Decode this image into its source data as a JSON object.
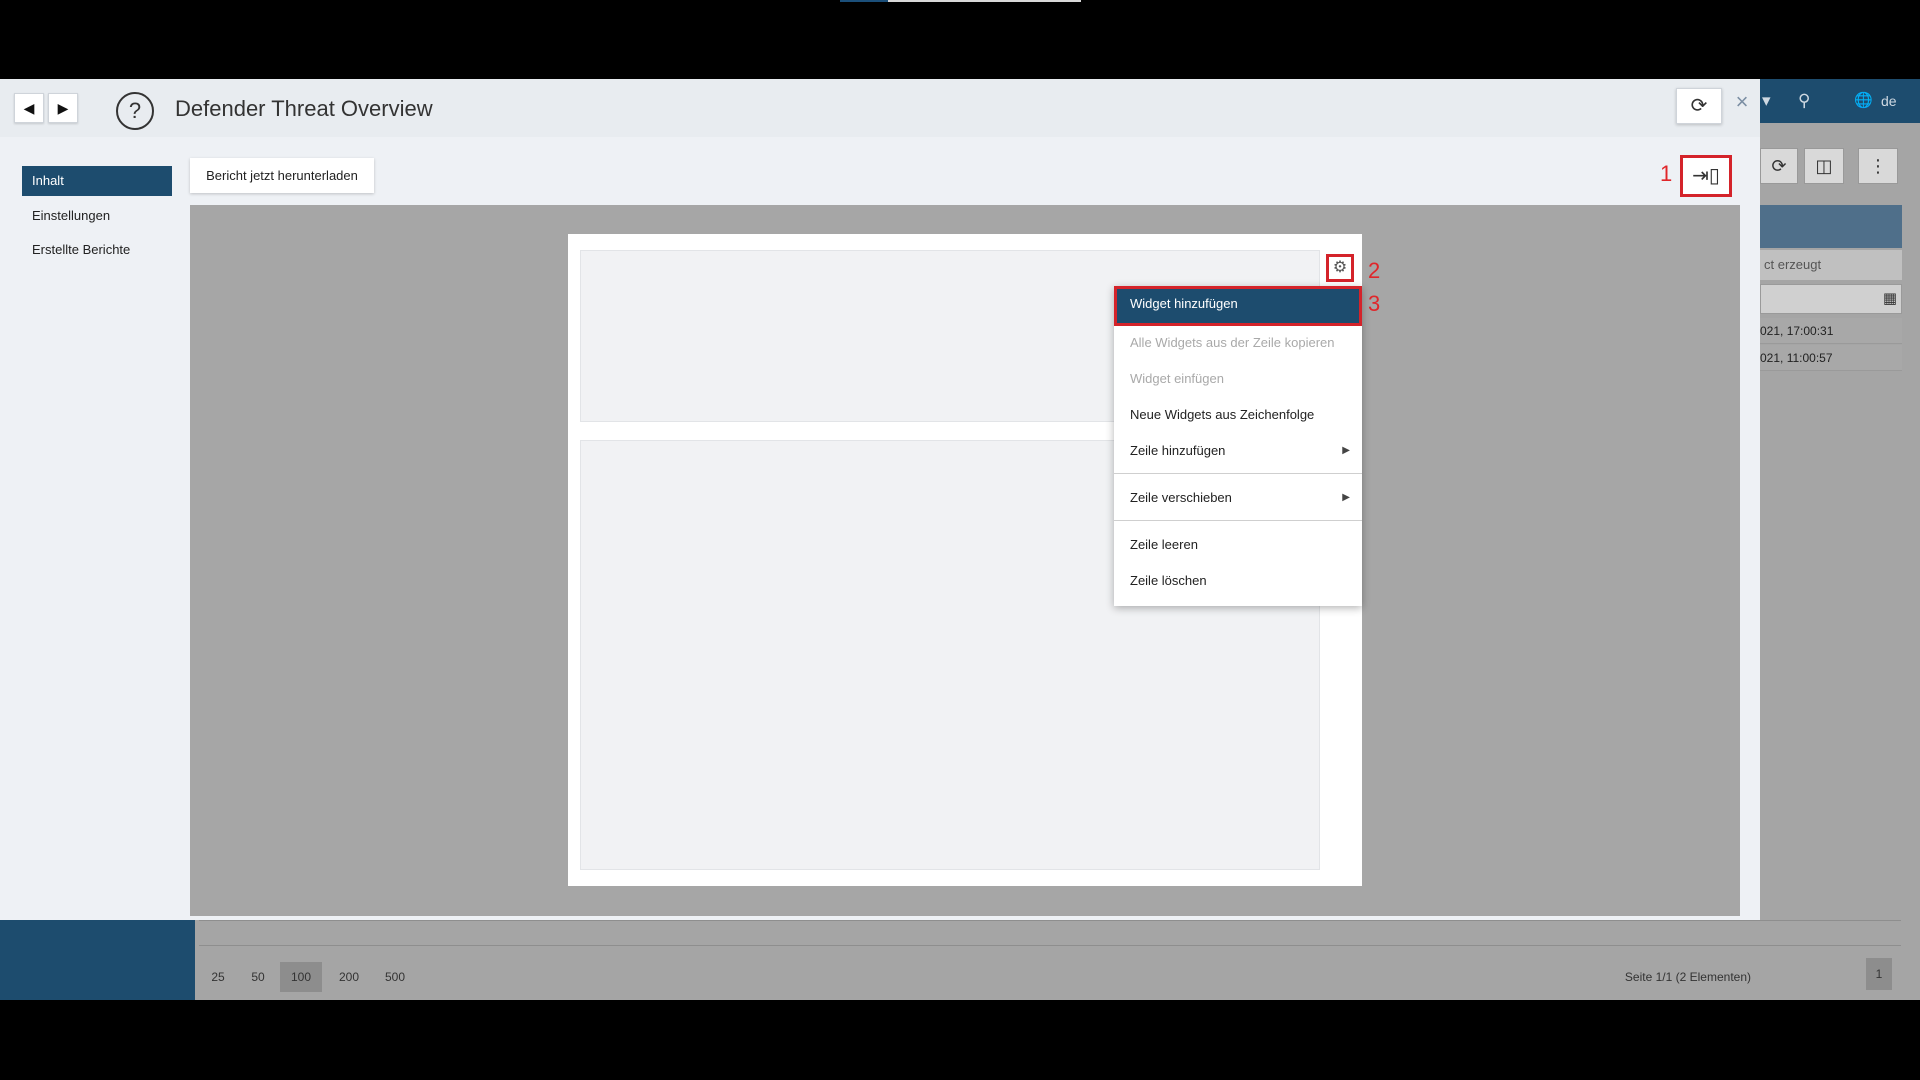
{
  "screen": {
    "top_strip": true
  },
  "background_app": {
    "topbar": {
      "dropdown_glyph": "▾",
      "search_glyph": "⚲",
      "globe_glyph": "🌐",
      "language": "de"
    },
    "toolbar": {
      "refresh_glyph": "⟳",
      "split_glyph": "◫",
      "more_glyph": "⋮"
    },
    "column_header": "ct erzeugt",
    "rows": [
      "021, 17:00:31",
      "021, 11:00:57"
    ],
    "pagination": {
      "sizes": [
        "25",
        "50",
        "100",
        "200",
        "500"
      ],
      "selected_size": "100",
      "info": "Seite 1/1 (2 Elementen)",
      "page": "1"
    }
  },
  "modal": {
    "title": "Defender Threat Overview",
    "back_glyph": "◀",
    "forward_glyph": "▶",
    "help_glyph": "?",
    "refresh_glyph": "⟳",
    "close_glyph": "×",
    "sidebar": {
      "items": [
        {
          "label": "Inhalt",
          "active": true
        },
        {
          "label": "Einstellungen",
          "active": false
        },
        {
          "label": "Erstellte Berichte",
          "active": false
        }
      ]
    },
    "download_button": "Bericht jetzt herunterladen",
    "layout_icon_glyph": "⇥▯",
    "gear_glyph": "⚙",
    "annotations": [
      "1",
      "2",
      "3"
    ],
    "context_menu": {
      "items": [
        {
          "label": "Widget hinzufügen",
          "state": "highlighted"
        },
        {
          "label": "Alle Widgets aus der Zeile kopieren",
          "state": "disabled"
        },
        {
          "label": "Widget einfügen",
          "state": "disabled"
        },
        {
          "label": "Neue Widgets aus Zeichenfolge",
          "state": "enabled"
        },
        {
          "label": "Zeile hinzufügen",
          "state": "enabled",
          "submenu": true
        },
        {
          "label": "Zeile verschieben",
          "state": "enabled",
          "submenu": true
        },
        {
          "label": "Zeile leeren",
          "state": "enabled"
        },
        {
          "label": "Zeile löschen",
          "state": "enabled"
        }
      ],
      "submenu_glyph": "▶"
    }
  },
  "colors": {
    "accent": "#1d4c6e",
    "highlight_border": "#d4232a",
    "overlay": "#a5a5a5"
  }
}
